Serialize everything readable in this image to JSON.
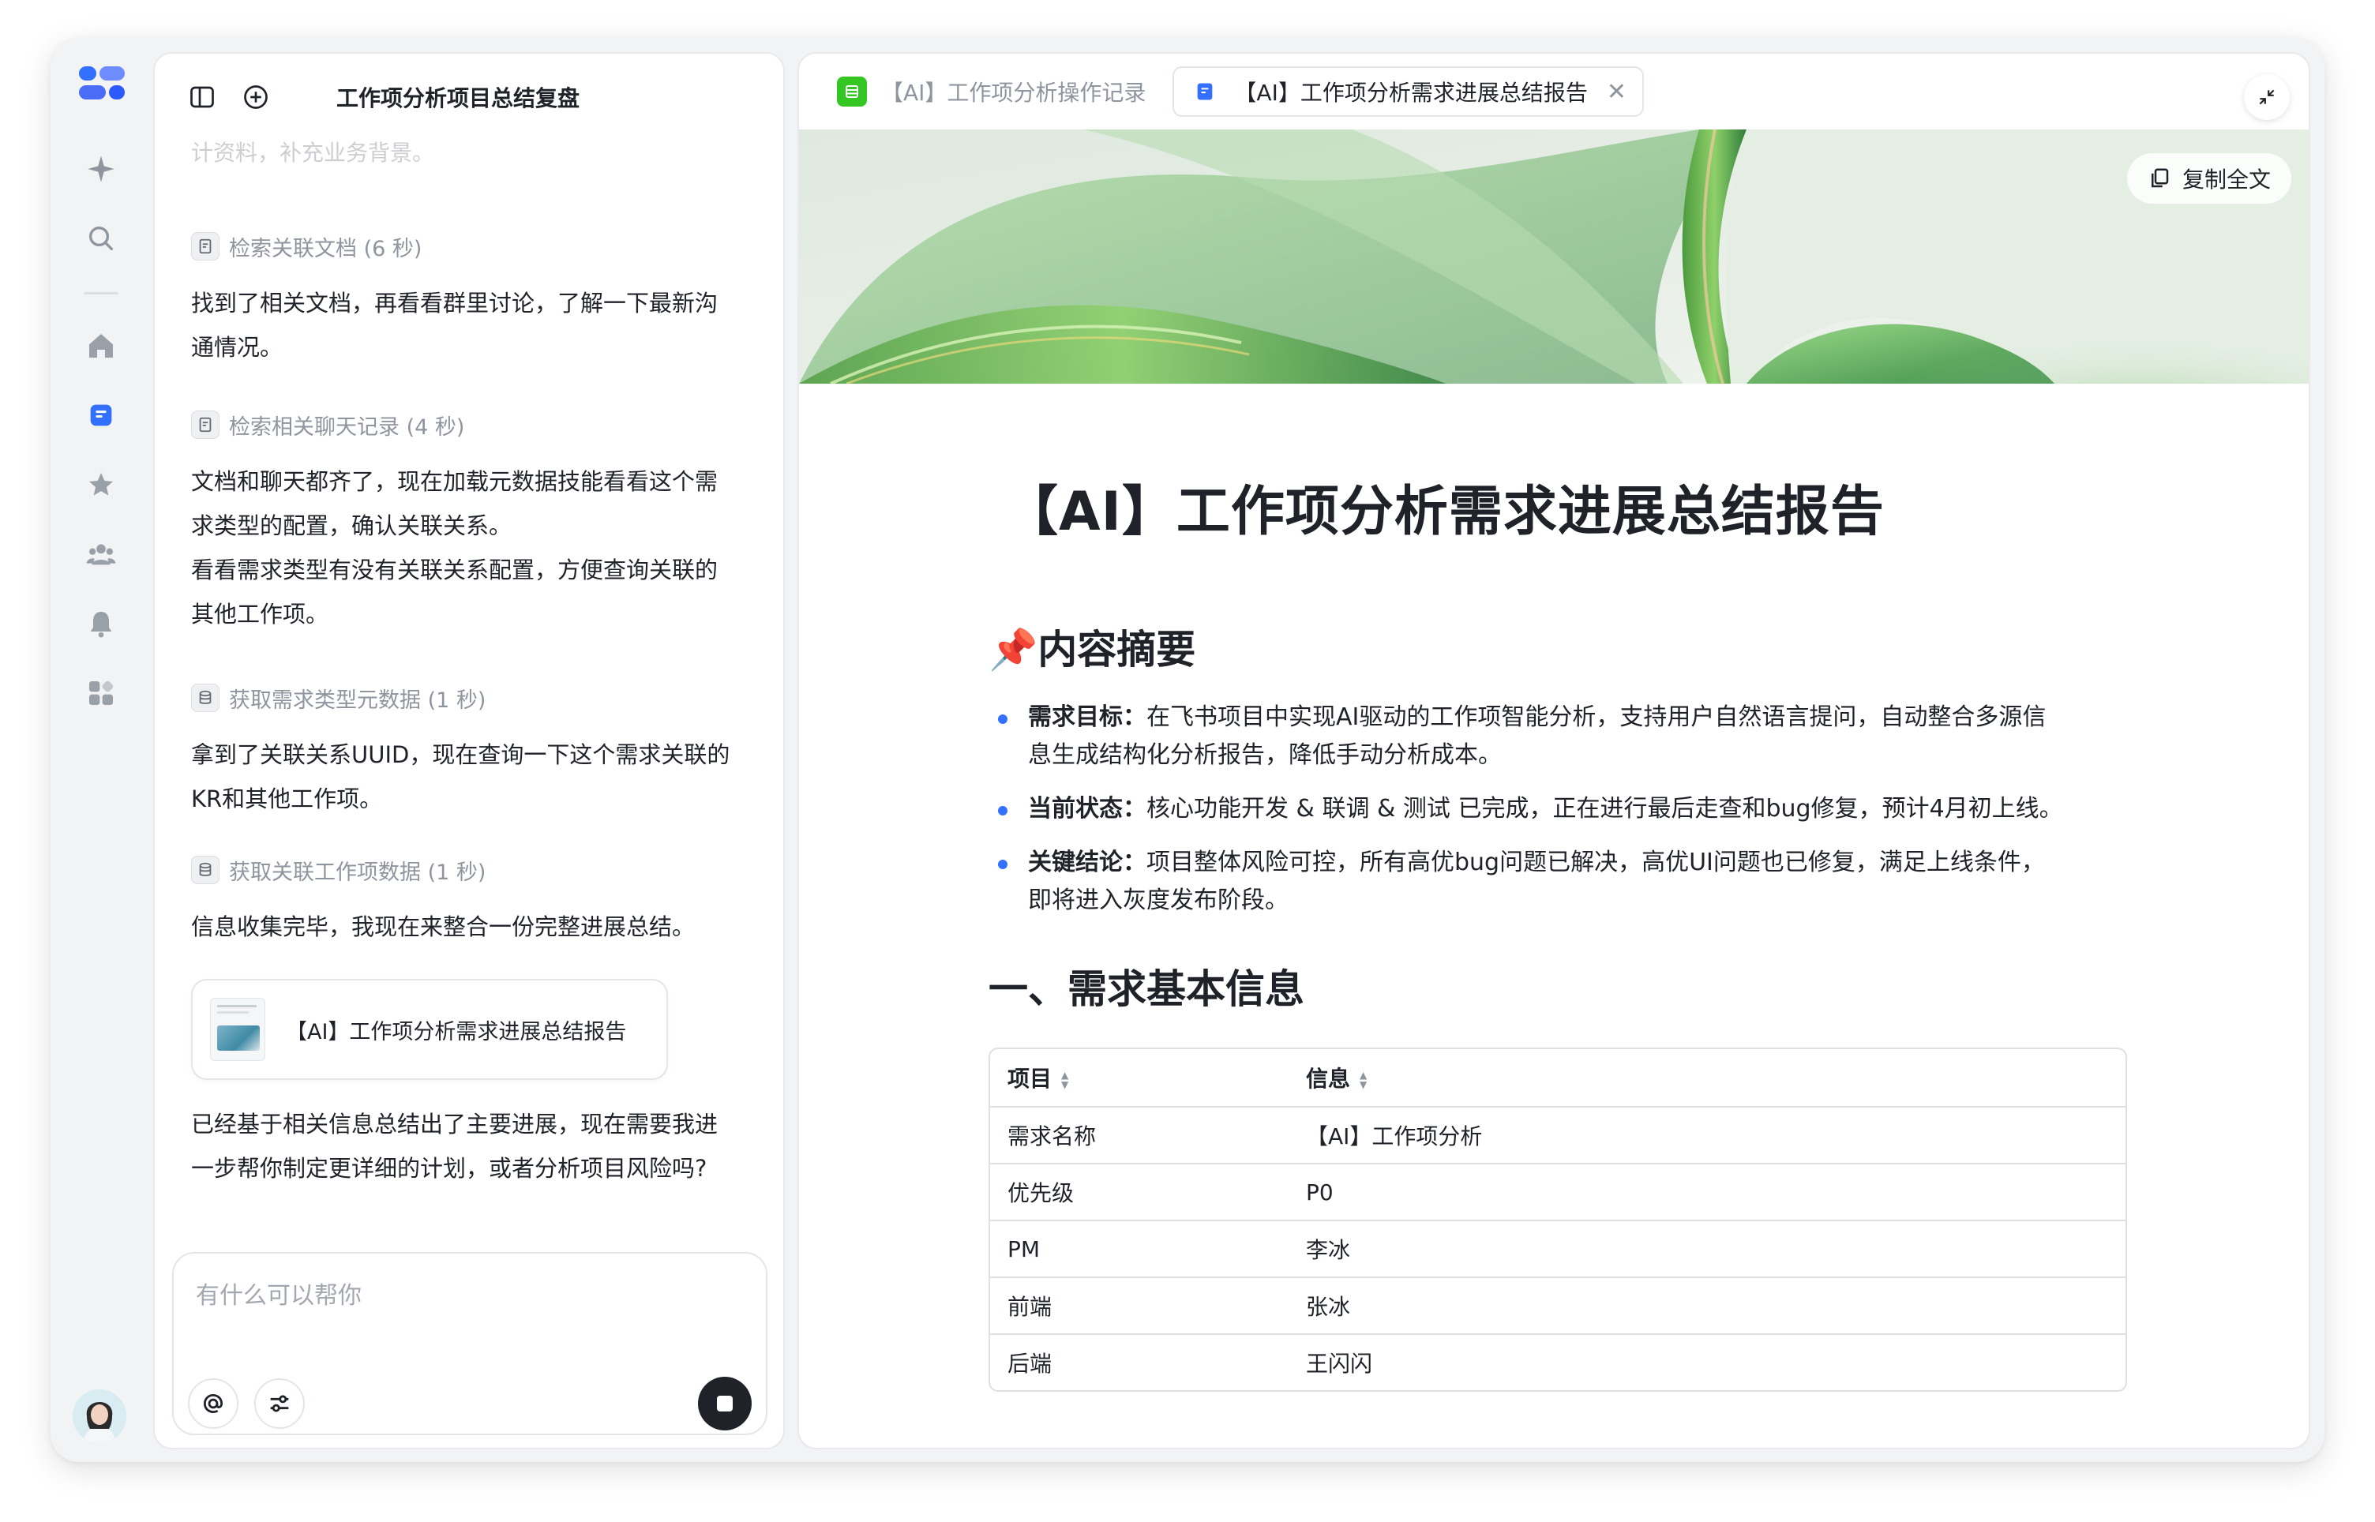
{
  "colors": {
    "accent": "#3370ff",
    "brand": "#4a6cf7",
    "bullet": "#3370ff",
    "dark": "#1f2329",
    "muted": "#8f959e"
  },
  "rail": {
    "items": [
      "sparkle-icon",
      "search-icon",
      "home-icon",
      "doc-icon",
      "star-icon",
      "group-icon",
      "bell-icon",
      "apps-icon"
    ]
  },
  "chat": {
    "title": "工作项分析项目总结复盘",
    "cut_line": "计资料，补充业务背景。",
    "blocks": [
      {
        "tool": "检索关联文档 (6 秒)"
      },
      {
        "msg": "找到了相关文档，再看看群里讨论，了解一下最新沟通情况。"
      },
      {
        "tool": "检索相关聊天记录 (4 秒)"
      },
      {
        "msg": "文档和聊天都齐了，现在加载元数据技能看看这个需求类型的配置，确认关联关系。\n看看需求类型有没有关联关系配置，方便查询关联的其他工作项。"
      },
      {
        "tool": "获取需求类型元数据 (1 秒)"
      },
      {
        "msg": "拿到了关联关系UUID，现在查询一下这个需求关联的KR和其他工作项。"
      },
      {
        "tool": "获取关联工作项数据 (1 秒)"
      },
      {
        "msg": "信息收集完毕，我现在来整合一份完整进展总结。"
      }
    ],
    "tool_1": "检索关联文档 (6 秒)",
    "msg_1a": "找到了相关文档，再看看群里讨论，了解一下最新沟",
    "msg_1b": "通情况。",
    "tool_2": "检索相关聊天记录 (4 秒)",
    "msg_2a": "文档和聊天都齐了，现在加载元数据技能看看这个需",
    "msg_2b": "求类型的配置，确认关联关系。",
    "msg_2c": "看看需求类型有没有关联关系配置，方便查询关联的",
    "msg_2d": "其他工作项。",
    "tool_3": "获取需求类型元数据 (1 秒)",
    "msg_3a": "拿到了关联关系UUID，现在查询一下这个需求关联的",
    "msg_3b": "KR和其他工作项。",
    "tool_4": "获取关联工作项数据 (1 秒)",
    "msg_4": "信息收集完毕，我现在来整合一份完整进展总结。",
    "doc_card_label": "【AI】工作项分析需求进展总结报告",
    "final_a": "已经基于相关信息总结出了主要进展，现在需要我进",
    "final_b": "一步帮你制定更详细的计划，或者分析项目风险吗?",
    "composer_placeholder": "有什么可以帮你"
  },
  "doc": {
    "tab1": "【AI】工作项分析操作记录",
    "tab2": "【AI】工作项分析需求进展总结报告",
    "copy_label": "复制全文",
    "title": "【AI】工作项分析需求进展总结报告",
    "summary_heading": "📌内容摘要",
    "bullets": [
      {
        "label": "需求目标：",
        "text": "在飞书项目中实现AI驱动的工作项智能分析，支持用户自然语言提问，自动整合多源信息生成结构化分析报告，降低手动分析成本。"
      },
      {
        "label": "当前状态：",
        "text": "核心功能开发 & 联调 & 测试 已完成，正在进行最后走查和bug修复，预计4月初上线。"
      },
      {
        "label": "关键结论：",
        "text": "项目整体风险可控，所有高优bug问题已解决，高优UI问题也已修复，满足上线条件，即将进入灰度发布阶段。"
      }
    ],
    "b1_label": "需求目标：",
    "b1_a": "在飞书项目中实现AI驱动的工作项智能分析，支持用户自然语言提问，自动整合多源信",
    "b1_b": "息生成结构化分析报告，降低手动分析成本。",
    "b2_label": "当前状态：",
    "b2_text": "核心功能开发 & 联调 & 测试 已完成，正在进行最后走查和bug修复，预计4月初上线。",
    "b3_label": "关键结论：",
    "b3_a": "项目整体风险可控，所有高优bug问题已解决，高优UI问题也已修复，满足上线条件，",
    "b3_b": "即将进入灰度发布阶段。",
    "section1": "一、需求基本信息",
    "table": {
      "headers": [
        "项目",
        "信息"
      ],
      "rows": [
        [
          "需求名称",
          "【AI】工作项分析"
        ],
        [
          "优先级",
          "P0"
        ],
        [
          "PM",
          "李冰"
        ],
        [
          "前端",
          "张冰"
        ],
        [
          "后端",
          "王闪闪"
        ]
      ]
    }
  }
}
